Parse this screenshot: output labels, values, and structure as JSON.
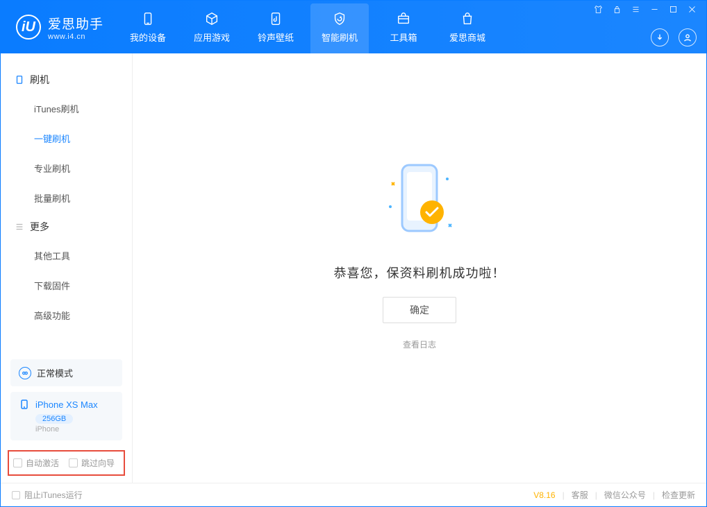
{
  "app": {
    "name_cn": "爱思助手",
    "name_en": "www.i4.cn",
    "logo_letter": "iU"
  },
  "tabs": [
    {
      "label": "我的设备"
    },
    {
      "label": "应用游戏"
    },
    {
      "label": "铃声壁纸"
    },
    {
      "label": "智能刷机"
    },
    {
      "label": "工具箱"
    },
    {
      "label": "爱思商城"
    }
  ],
  "sidebar": {
    "group1": {
      "title": "刷机",
      "items": [
        "iTunes刷机",
        "一键刷机",
        "专业刷机",
        "批量刷机"
      ]
    },
    "group2": {
      "title": "更多",
      "items": [
        "其他工具",
        "下载固件",
        "高级功能"
      ]
    }
  },
  "status": {
    "mode": "正常模式"
  },
  "device": {
    "name": "iPhone XS Max",
    "storage": "256GB",
    "type": "iPhone"
  },
  "options": {
    "auto_activate": "自动激活",
    "skip_guide": "跳过向导"
  },
  "main": {
    "success": "恭喜您，保资料刷机成功啦！",
    "ok": "确定",
    "log": "查看日志"
  },
  "footer": {
    "block_itunes": "阻止iTunes运行",
    "version": "V8.16",
    "links": [
      "客服",
      "微信公众号",
      "检查更新"
    ]
  }
}
